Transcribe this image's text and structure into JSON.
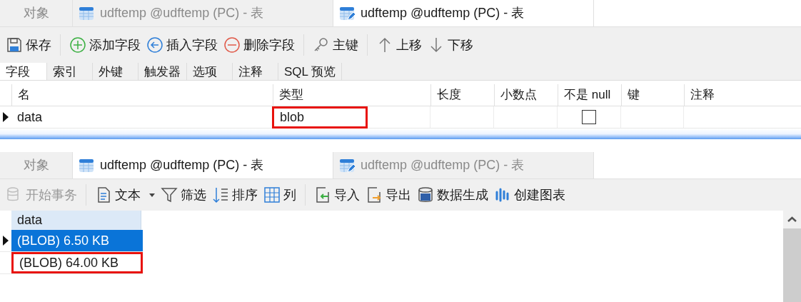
{
  "top": {
    "tabs": [
      {
        "label": "对象",
        "kind": "plain",
        "selected": false
      },
      {
        "label": "udftemp @udftemp (PC) - 表",
        "kind": "table",
        "selected": false
      },
      {
        "label": "udftemp @udftemp (PC) - 表",
        "kind": "design",
        "selected": true
      }
    ],
    "toolbar": [
      {
        "label": "保存",
        "kind": "save",
        "group_start": false
      },
      {
        "label": "添加字段",
        "kind": "add",
        "group_start": true
      },
      {
        "label": "插入字段",
        "kind": "insert",
        "group_start": false
      },
      {
        "label": "删除字段",
        "kind": "delete",
        "group_start": false
      },
      {
        "label": "主键",
        "kind": "key",
        "group_start": true
      },
      {
        "label": "上移",
        "kind": "up",
        "group_start": true
      },
      {
        "label": "下移",
        "kind": "down",
        "group_start": false
      }
    ],
    "subtabs": [
      {
        "label": "字段",
        "selected": true
      },
      {
        "label": "索引",
        "selected": false
      },
      {
        "label": "外键",
        "selected": false
      },
      {
        "label": "触发器",
        "selected": false
      },
      {
        "label": "选项",
        "selected": false
      },
      {
        "label": "注释",
        "selected": false
      },
      {
        "label": "SQL 预览",
        "selected": false
      }
    ],
    "columns": [
      "名",
      "类型",
      "长度",
      "小数点",
      "不是 null",
      "键",
      "注释"
    ],
    "rows": [
      {
        "current": true,
        "name": "data",
        "type": "blob",
        "type_highlighted": true,
        "length": "",
        "decimals": "",
        "not_null": false,
        "key": "",
        "comment": ""
      }
    ]
  },
  "bottom": {
    "tabs": [
      {
        "label": "对象",
        "kind": "plain",
        "selected": false
      },
      {
        "label": "udftemp @udftemp (PC) - 表",
        "kind": "table",
        "selected": true
      },
      {
        "label": "udftemp @udftemp (PC) - 表",
        "kind": "design",
        "selected": false
      }
    ],
    "toolbar": [
      {
        "label": "开始事务",
        "kind": "transaction",
        "disabled": true,
        "dropdown": false,
        "group_start": false
      },
      {
        "label": "文本",
        "kind": "text",
        "disabled": false,
        "dropdown": true,
        "group_start": true
      },
      {
        "label": "筛选",
        "kind": "filter",
        "disabled": false,
        "dropdown": false,
        "group_start": false
      },
      {
        "label": "排序",
        "kind": "sort",
        "disabled": false,
        "dropdown": false,
        "group_start": false
      },
      {
        "label": "列",
        "kind": "columns",
        "disabled": false,
        "dropdown": false,
        "group_start": false
      },
      {
        "label": "导入",
        "kind": "import",
        "disabled": false,
        "dropdown": false,
        "group_start": true
      },
      {
        "label": "导出",
        "kind": "export",
        "disabled": false,
        "dropdown": false,
        "group_start": false
      },
      {
        "label": "数据生成",
        "kind": "datagen",
        "disabled": false,
        "dropdown": false,
        "group_start": false
      },
      {
        "label": "创建图表",
        "kind": "chart",
        "disabled": false,
        "dropdown": false,
        "group_start": false
      }
    ],
    "grid": {
      "column": "data",
      "rows": [
        {
          "value": "(BLOB) 6.50 KB",
          "selected": true,
          "current": true,
          "highlighted": false
        },
        {
          "value": "(BLOB) 64.00 KB",
          "selected": false,
          "current": false,
          "highlighted": true
        }
      ]
    }
  }
}
